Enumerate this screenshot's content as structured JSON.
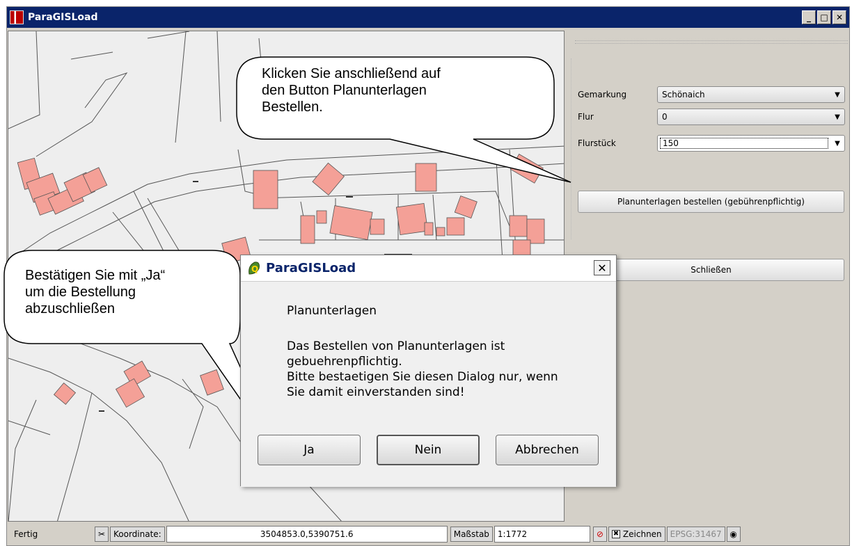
{
  "window": {
    "title": "ParaGISLoad",
    "controls": [
      "minimize",
      "maximize",
      "close"
    ]
  },
  "form": {
    "gemarkung": {
      "label": "Gemarkung",
      "value": "Schönaich"
    },
    "flur": {
      "label": "Flur",
      "value": "0"
    },
    "flurstueck": {
      "label": "Flurstück",
      "value": "150"
    }
  },
  "buttons": {
    "order_label": "Planunterlagen bestellen (gebührenpflichtig)",
    "close_label": "Schließen"
  },
  "statusbar": {
    "status": "Fertig",
    "coord_label": "Koordinate:",
    "coord_value": "3504853.0,5390751.6",
    "scale_label": "Maßstab",
    "scale_value": "1:1772",
    "draw_label": "Zeichnen",
    "crs": "EPSG:31467"
  },
  "dialog": {
    "title": "ParaGISLoad",
    "heading": "Planunterlagen",
    "message_lines": [
      "Das Bestellen von Planunterlagen ist",
      "gebuehrenpflichtig.",
      "Bitte bestaetigen Sie diesen Dialog nur, wenn",
      "Sie damit einverstanden sind!"
    ],
    "buttons": {
      "yes": "Ja",
      "no": "Nein",
      "cancel": "Abbrechen"
    }
  },
  "callouts": {
    "top": [
      "Klicken Sie anschließend auf",
      "den Button Planunterlagen",
      "Bestellen."
    ],
    "left": [
      "Bestätigen Sie mit „Ja“",
      "um die Bestellung",
      "abzuschließen"
    ]
  },
  "colors": {
    "titlebar": "#0a246a",
    "building": "#f4a097",
    "map_bg": "#eeeeee"
  }
}
